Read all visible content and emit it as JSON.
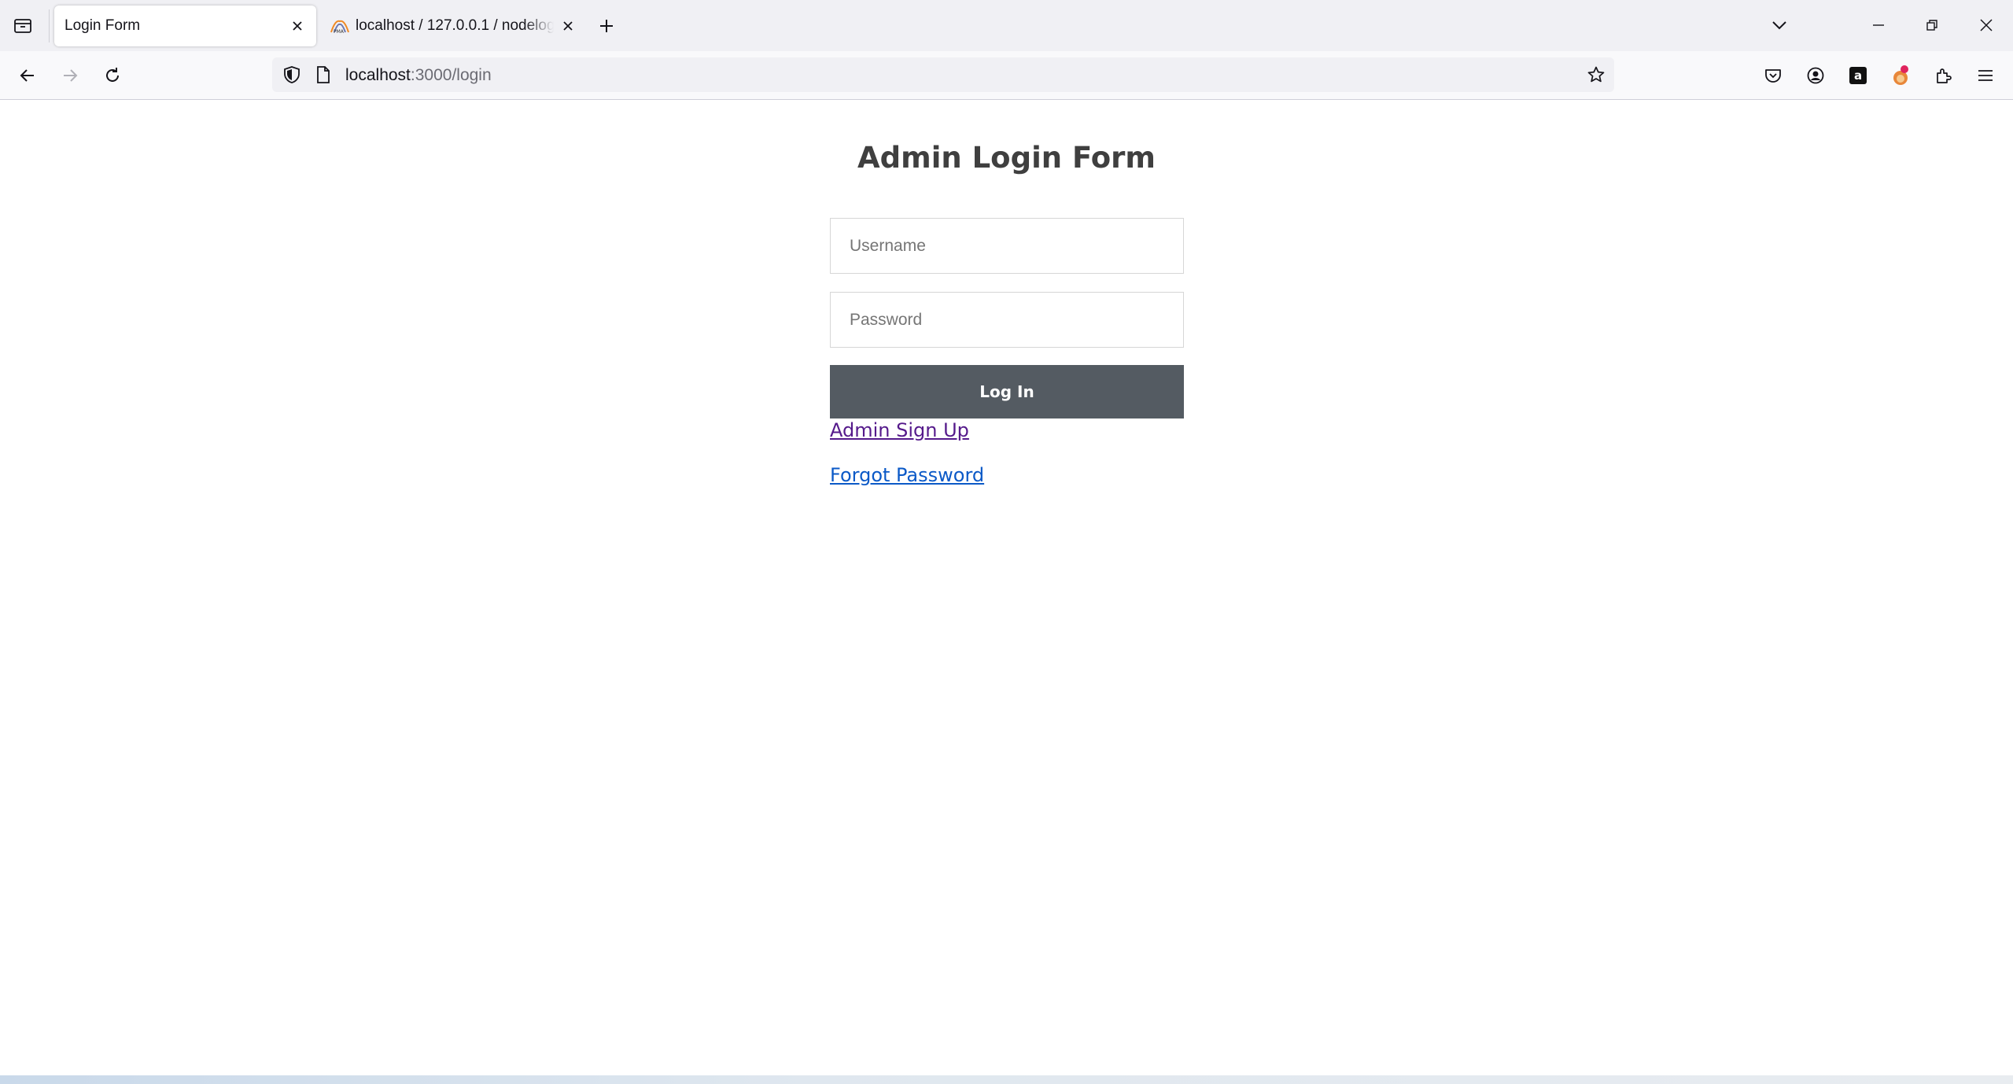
{
  "browser": {
    "tabs": [
      {
        "title": "Login Form",
        "active": true
      },
      {
        "title": "localhost / 127.0.0.1 / nodelogin",
        "active": false,
        "favicon": "phpmyadmin-icon"
      }
    ],
    "url": {
      "host": "localhost",
      "path": ":3000/login"
    },
    "icons": {
      "tab_list": "tab-list-icon",
      "new_tab": "plus-icon",
      "list_all_tabs": "chevron-down-icon",
      "minimize": "minimize-icon",
      "restore": "restore-icon",
      "close": "close-icon",
      "back": "back-arrow-icon",
      "forward": "forward-arrow-icon",
      "reload": "reload-icon",
      "shield": "shield-icon",
      "page": "page-icon",
      "bookmark": "star-icon",
      "pocket": "pocket-icon",
      "account": "account-icon",
      "amazon": "amazon-icon",
      "extension_fox": "fox-extension-icon",
      "extensions": "puzzle-icon",
      "menu": "hamburger-menu-icon"
    }
  },
  "page": {
    "title": "Admin Login Form",
    "username_placeholder": "Username",
    "password_placeholder": "Password",
    "login_label": "Log In",
    "signup_link": "Admin Sign Up",
    "forgot_link": "Forgot Password"
  },
  "colors": {
    "button_bg": "#545b62",
    "visited_link": "#551a8b",
    "link": "#0b59c7",
    "title_text": "#3f3f3f"
  }
}
